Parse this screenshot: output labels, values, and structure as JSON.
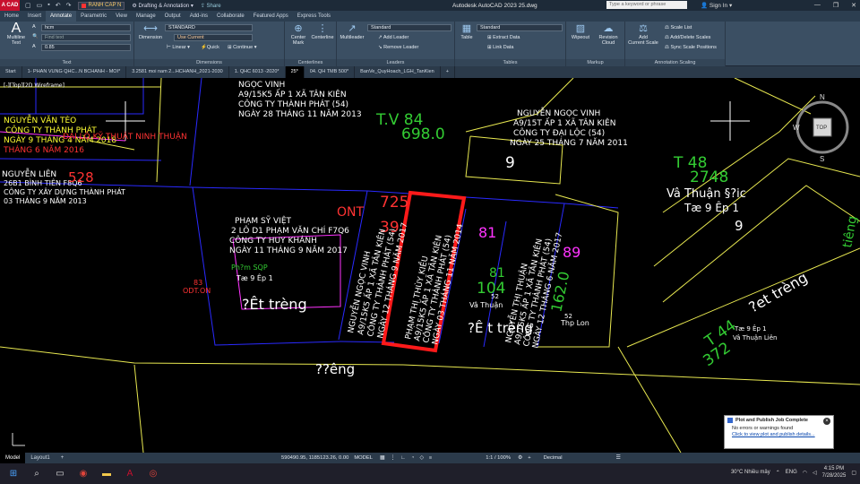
{
  "titlebar": {
    "logo": "A CAD",
    "layer_name": "RANH CAP N",
    "workspace": "Drafting & Annotation",
    "share": "Share",
    "title": "Autodesk AutoCAD 2023   25.dwg",
    "search_placeholder": "Type a keyword or phrase",
    "signin": "Sign In"
  },
  "ribbon_tabs": [
    "Home",
    "Insert",
    "Annotate",
    "Parametric",
    "View",
    "Manage",
    "Output",
    "Add-ins",
    "Collaborate",
    "Featured Apps",
    "Express Tools"
  ],
  "active_ribbon_tab": "Annotate",
  "ribbon": {
    "text_panel": {
      "title": "Text",
      "multiline": "Multiline",
      "multiline2": "Text",
      "style": "hcm",
      "find": "Find text",
      "height": "0.85"
    },
    "dimensions_panel": {
      "title": "Dimensions",
      "dimension": "Dimension",
      "style": "STANDARD",
      "layer": "Use Current",
      "linear": "Linear",
      "quick": "Quick",
      "continue": "Continue"
    },
    "centerlines_panel": {
      "title": "Centerlines",
      "center_mark": "Center",
      "center_mark2": "Mark",
      "centerline": "Centerline"
    },
    "leaders_panel": {
      "title": "Leaders",
      "multileader": "Multileader",
      "style": "Standard",
      "add": "Add Leader",
      "remove": "Remove Leader"
    },
    "tables_panel": {
      "title": "Tables",
      "table": "Table",
      "style": "Standard",
      "extract": "Extract Data",
      "link": "Link Data"
    },
    "markup_panel": {
      "title": "Markup",
      "wipeout": "Wipeout",
      "revision": "Revision",
      "revision2": "Cloud"
    },
    "scaling_panel": {
      "title": "Annotation Scaling",
      "add": "Add",
      "add2": "Current Scale",
      "scale_list": "Scale List",
      "add_delete": "Add/Delete Scales",
      "sync": "Sync Scale Positions"
    }
  },
  "doc_tabs": [
    "Start",
    "1- PHAN VUNG QHC...N BCHANH - MOI*",
    "3.2581 moi nam 2...HCHANH_2021-2030",
    "1. QHC 6013 -2020*",
    "25*",
    "04. QH TMB 500*",
    "BanVe_QuyHoach_LGH_TanKien"
  ],
  "active_doc_tab": "25*",
  "canvas_labels": {
    "viewport": "[-][Top][2D Wireframe]",
    "owner_tl1": "NGUYỄN VĂN TÈO",
    "owner_tl2": "CÔNG TY THÀNH PHÁT",
    "owner_tl3": "NGÀY 9 THÁNG 4 NĂM 2018",
    "owner_tl4": "THÁNG 6 NĂM 2016",
    "red_road": "ĐẠI LỘ KỸ THUẬT NINH THUẬN",
    "owner_ml1": "NGUYỄN LIÊN",
    "owner_ml2": "26B1 BÌNH TIÊN F8Q6",
    "owner_ml3": "CÔNG TY XÂY DỰNG THÀNH PHÁT",
    "owner_ml4": "03 THÁNG 9 NĂM 2013",
    "lot528": "528",
    "owner_tc1": "NGỌC VINH",
    "owner_tc2": "A9/15K5 ẤP 1 XÃ TÂN KIÊN",
    "owner_tc3": "CÔNG TY THÀNH PHÁT (54)",
    "owner_tc4": "NGÀY 28 THÁNG 11 NĂM 2013",
    "tv84": "T.V 84",
    "area698": "698.0",
    "owner_tr1": "NGUYỄN NGỌC VINH",
    "owner_tr2": "A9/15T ẤP 1 XÃ TÂN KIÊN",
    "owner_tr3": "CÔNG TY ĐẠI LỘC (54)",
    "owner_tr4": "NGÀY 25 THÁNG 7 NĂM 2011",
    "lot9": "9",
    "t48": "T 48",
    "area2748": "2748",
    "va_thuan": "Vâ Thuận §?ic",
    "to9ep1": "Tæ 9 Êp 1",
    "lot9b": "9",
    "ont": "ONT",
    "lot725": "725",
    "lot39": "39",
    "owner_c1": "PHẠM SỸ VIỆT",
    "owner_c2": "2 LÔ D1 PHẠM VĂN CHÍ F7Q6",
    "owner_c3": "CÔNG TY HUY KHÁNH",
    "owner_c4": "NGÀY 11 THÁNG 9 NĂM 2017",
    "lot81": "81",
    "lot89": "89",
    "lot83": "83",
    "odt": "ODT.ON",
    "pham": "Ph?m SQP",
    "to9": "Tæ 9 Êp 1",
    "et_treng": "?Êt trèng",
    "et_treng2": "?Ê t trèng",
    "et_treng3": "?et trèng",
    "road": "??êng",
    "lot81b": "81",
    "area104": "104",
    "va_thuan2": "Vâ Thuận",
    "lot52": "52",
    "thp_lon": "Thp Lon",
    "lot52b": "52",
    "t44": "T 44",
    "area372": "372",
    "va_thuan3": "Vâ Thuận Liên",
    "ep1": "Tæ 9 Êp 1",
    "v_right1": "NGUYỄN NGỌC VINH",
    "v_right2": "A9/15K5 ẤP 1 XÃ TÂN KIÊN",
    "v_right3": "CÔNG TY THÀNH PHÁT (54)",
    "v_right4": "NGÀY 12 THÁNG 9 NĂM 2017",
    "v_sel1": "PHẠM THỊ THÙY KIỀU",
    "v_sel2": "A9/15K5 ẤP 1 XÃ TÂN KIÊN",
    "v_sel3": "CÔNG TY THÀNH PHÁT (54)",
    "v_sel4": "NGÀY 03 THÁNG 11 NĂM 2014",
    "v_r2a": "NGUYỄN THỊ THUẬN",
    "v_r2b": "A9/15K5 ẤP 1 XÃ TÂN KIÊN",
    "v_r2c": "CÔNG TY THÀNH PHÁT (54)",
    "v_r2d": "NGÀY 12 THÁNG 6 NĂM 2017",
    "area1620": "162.0",
    "viewcube_top": "TOP",
    "compass_n": "N",
    "compass_w": "W",
    "compass_s": "S",
    "right_text": "tiêng"
  },
  "notification": {
    "title": "Plot and Publish Job Complete",
    "body": "No errors or warnings found",
    "link": "Click to view plot and publish details..."
  },
  "layout_tabs": [
    "Model",
    "Layout1"
  ],
  "active_layout_tab": "Model",
  "status": {
    "coords": "590490.95, 1185123.26, 0.00",
    "model": "MODEL",
    "scale": "1:1 / 100%",
    "units": "Decimal"
  },
  "taskbar": {
    "weather": "30°C  Nhiều mây",
    "lang": "ENG",
    "time": "4:15 PM",
    "date": "7/28/2025"
  },
  "colors": {
    "title_bg": "#1d2a38",
    "ribbon_bg": "#3b4f63",
    "selection": "#ff1a1a",
    "canvas_bg": "#000000"
  }
}
